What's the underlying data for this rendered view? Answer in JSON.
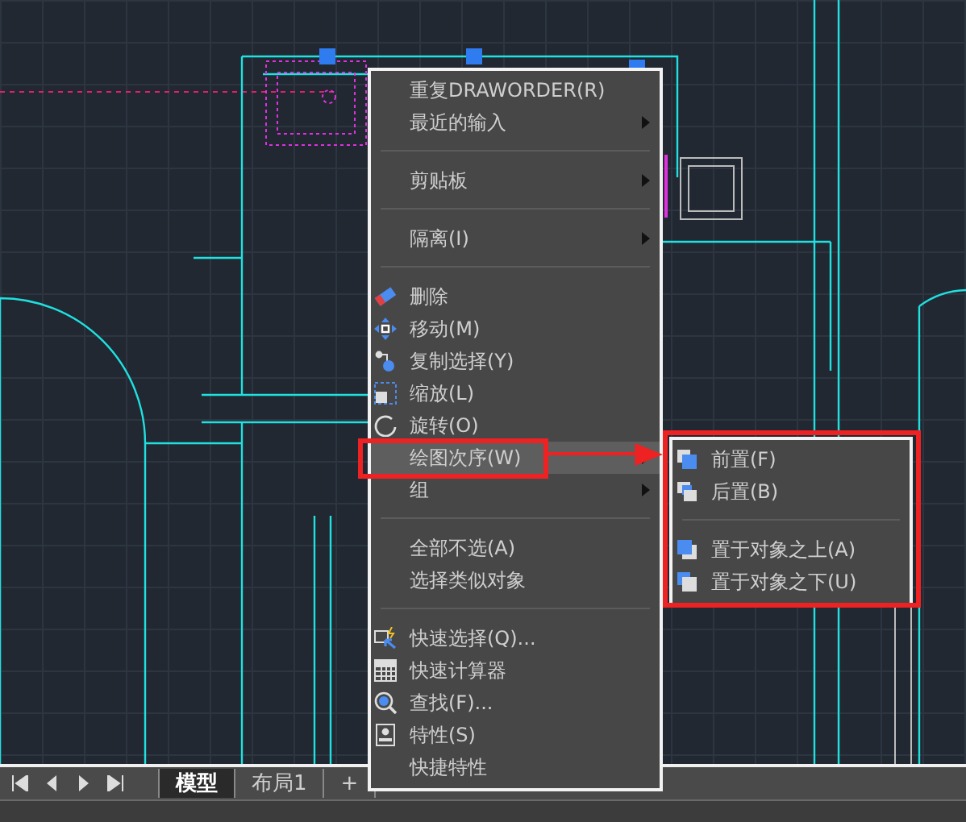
{
  "context_menu": {
    "items": [
      {
        "kind": "item",
        "label": "重复DRAWORDER(R)",
        "submenu": false,
        "selected": false
      },
      {
        "kind": "item",
        "label": "最近的输入",
        "submenu": true,
        "selected": false
      },
      {
        "kind": "separator"
      },
      {
        "kind": "item",
        "label": "剪贴板",
        "submenu": true,
        "selected": false
      },
      {
        "kind": "separator"
      },
      {
        "kind": "item",
        "label": "隔离(I)",
        "submenu": true,
        "selected": false
      },
      {
        "kind": "separator"
      },
      {
        "kind": "item",
        "label": "删除",
        "submenu": false,
        "selected": false
      },
      {
        "kind": "item",
        "label": "移动(M)",
        "submenu": false,
        "selected": false
      },
      {
        "kind": "item",
        "label": "复制选择(Y)",
        "submenu": false,
        "selected": false
      },
      {
        "kind": "item",
        "label": "缩放(L)",
        "submenu": false,
        "selected": false
      },
      {
        "kind": "item",
        "label": "旋转(O)",
        "submenu": false,
        "selected": false
      },
      {
        "kind": "item",
        "label": "绘图次序(W)",
        "submenu": true,
        "selected": true
      },
      {
        "kind": "item",
        "label": "组",
        "submenu": true,
        "selected": false
      },
      {
        "kind": "separator"
      },
      {
        "kind": "item",
        "label": "全部不选(A)",
        "submenu": false,
        "selected": false
      },
      {
        "kind": "item",
        "label": "选择类似对象",
        "submenu": false,
        "selected": false
      },
      {
        "kind": "separator"
      },
      {
        "kind": "item",
        "label": "快速选择(Q)...",
        "submenu": false,
        "selected": false
      },
      {
        "kind": "item",
        "label": "快速计算器",
        "submenu": false,
        "selected": false
      },
      {
        "kind": "item",
        "label": "查找(F)...",
        "submenu": false,
        "selected": false
      },
      {
        "kind": "item",
        "label": "特性(S)",
        "submenu": false,
        "selected": false
      },
      {
        "kind": "item",
        "label": "快捷特性",
        "submenu": false,
        "selected": false
      }
    ]
  },
  "submenu": {
    "items": [
      {
        "kind": "item",
        "label": "前置(F)"
      },
      {
        "kind": "item",
        "label": "后置(B)"
      },
      {
        "kind": "separator"
      },
      {
        "kind": "item",
        "label": "置于对象之上(A)"
      },
      {
        "kind": "item",
        "label": "置于对象之下(U)"
      }
    ]
  },
  "layout_tabs": [
    {
      "label": "模型",
      "selected": true
    },
    {
      "label": "布局1",
      "selected": false
    },
    {
      "label": "+",
      "selected": false
    }
  ]
}
